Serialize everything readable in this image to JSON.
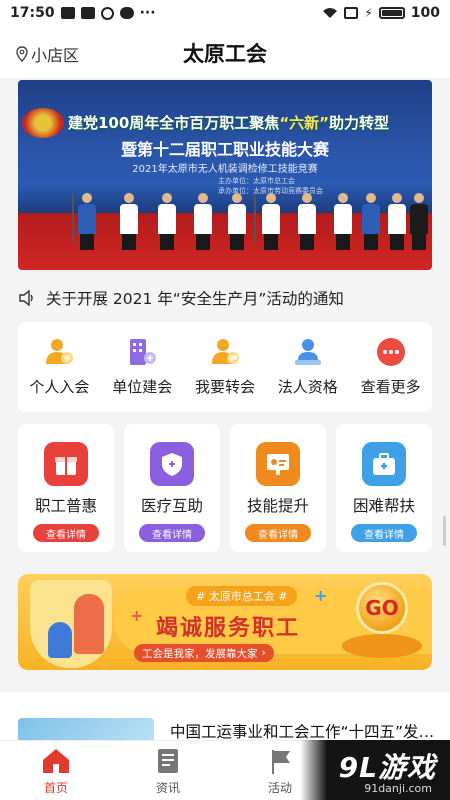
{
  "status_bar": {
    "time": "17:50",
    "battery": "100"
  },
  "header": {
    "location": "小店区",
    "title": "太原工会"
  },
  "banner": {
    "line1_a": "建党100周年全市百万职工聚焦",
    "line1_hl": "“六新”",
    "line1_b": "助力转型",
    "line2": "暨第十二届职工职业技能大赛",
    "line3": "2021年太原市无人机装调检修工技能竞赛",
    "small1": "主办单位：太原市总工会",
    "small2": "承办单位：太原市劳动竞赛委员会"
  },
  "notice": {
    "text": "关于开展 2021 年“安全生产月”活动的通知"
  },
  "quick_actions": [
    {
      "label": "个人入会",
      "icon": "person-add-icon"
    },
    {
      "label": "单位建会",
      "icon": "building-icon"
    },
    {
      "label": "我要转会",
      "icon": "person-transfer-icon"
    },
    {
      "label": "法人资格",
      "icon": "legal-person-icon"
    },
    {
      "label": "查看更多",
      "icon": "more-dots-icon"
    }
  ],
  "services": [
    {
      "title": "职工普惠",
      "button": "查看详情",
      "color": "#e8403a",
      "icon": "gift-icon"
    },
    {
      "title": "医疗互助",
      "button": "查看详情",
      "color": "#8b5fe0",
      "icon": "medical-shield-icon"
    },
    {
      "title": "技能提升",
      "button": "查看详情",
      "color": "#f08a1e",
      "icon": "skill-board-icon"
    },
    {
      "title": "困难帮扶",
      "button": "查看详情",
      "color": "#3fa0e8",
      "icon": "aid-kit-icon"
    }
  ],
  "promo": {
    "tag": "# 太原市总工会 #",
    "headline": "竭诚服务职工",
    "sub": "工会是我家，发展靠大家",
    "go": "GO"
  },
  "news": {
    "title": "中国工运事业和工会工作“十四五”发展规划"
  },
  "tabs": [
    {
      "label": "首页",
      "icon": "home-icon"
    },
    {
      "label": "资讯",
      "icon": "news-icon"
    },
    {
      "label": "活动",
      "icon": "flag-icon"
    }
  ],
  "watermark": {
    "logo": "9L游戏",
    "url": "91danji.com"
  },
  "colors": {
    "accent": "#e23b2e"
  }
}
